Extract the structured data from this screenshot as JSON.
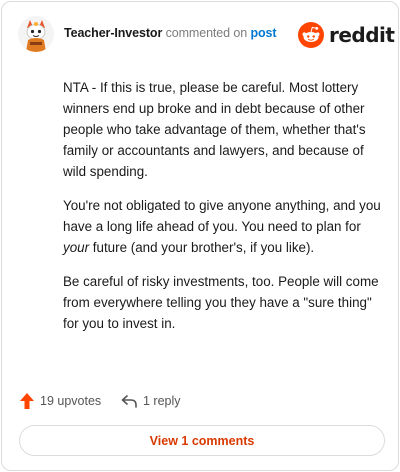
{
  "header": {
    "username": "Teacher-Investor",
    "action": "commented on",
    "link": "post",
    "brand": "reddit"
  },
  "comment": {
    "paragraphs": [
      "NTA - If this is true, please be careful. Most lottery winners end up broke and in debt because of other people who take advantage of them, whether that's family or accountants and lawyers, and because of wild spending.",
      {
        "before": "You're not obligated to give anyone anything, and you have a long life ahead of you. You need to plan for ",
        "emphasis": "your",
        "after": " future (and your brother's, if you like)."
      },
      "Be careful of risky investments, too. People will come from everywhere telling you they have a \"sure thing\" for you to invest in."
    ]
  },
  "footer": {
    "upvotes": "19 upvotes",
    "replies": "1 reply",
    "view_comments": "View 1 comments"
  },
  "icons": {
    "avatar": "snoo-avatar",
    "logo": "reddit-logo-icon",
    "upvote": "upvote-arrow-icon",
    "reply": "reply-arrow-icon"
  },
  "colors": {
    "reddit_orange": "#ff4500",
    "upvote_orange": "#ff4500",
    "link_blue": "#0079d3",
    "view_button_text": "#d93a00"
  }
}
